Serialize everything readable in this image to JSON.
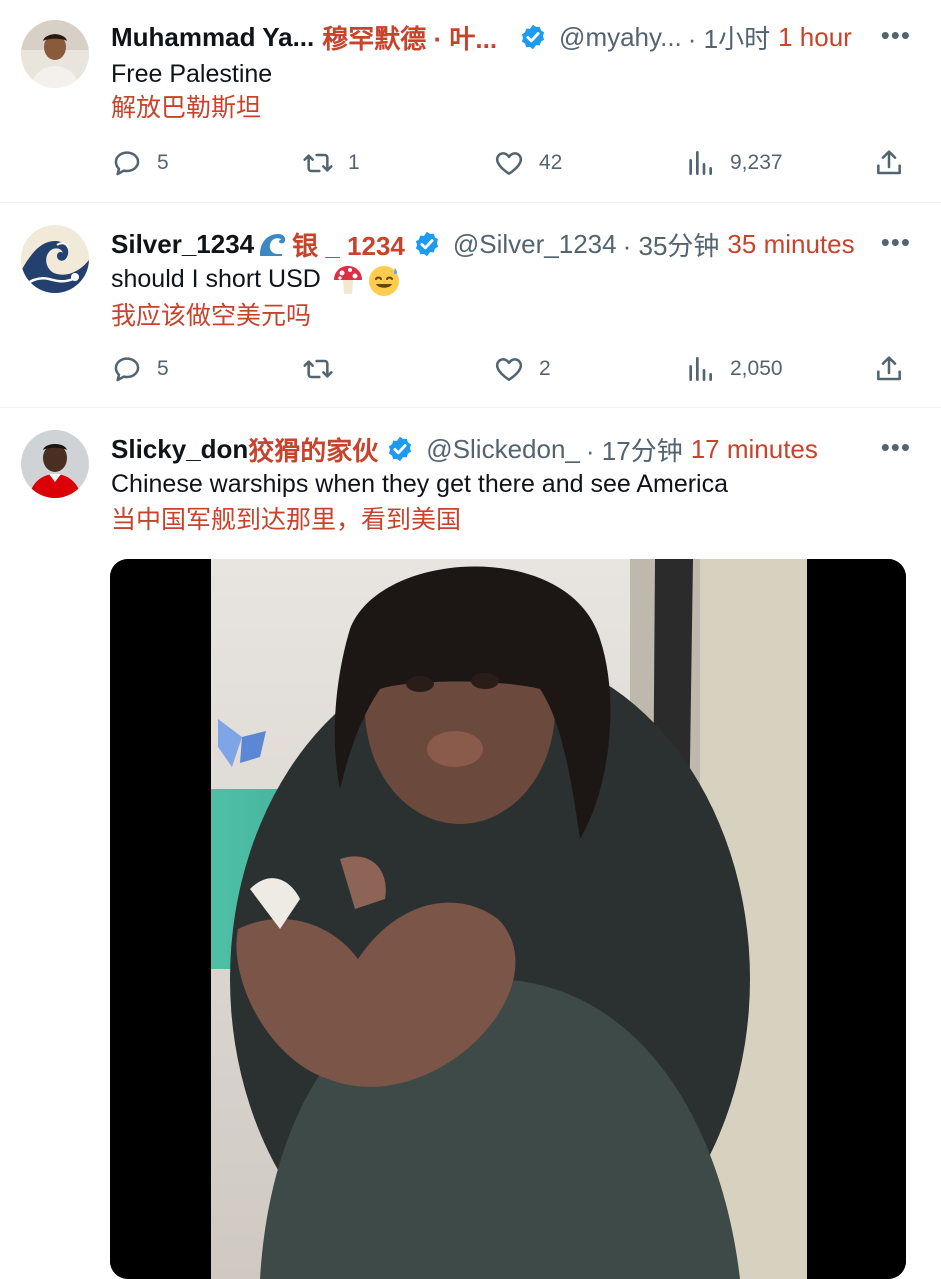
{
  "tweets": [
    {
      "name": "Muhammad Ya...",
      "name_zh": "穆罕默德 · 叶...",
      "handle": "@myahy...",
      "time_zh": "· 1小时",
      "time_en": "1 hour",
      "text": "Free Palestine",
      "text_zh": "解放巴勒斯坦",
      "replies": "5",
      "retweets": "1",
      "likes": "42",
      "views": "9,237"
    },
    {
      "name": "Silver_1234",
      "name_zh": "银 _ 1234",
      "handle": "@Silver_1234",
      "time_zh": "· 35分钟",
      "time_en": "35 minutes",
      "text": "should I short USD",
      "text_zh": "我应该做空美元吗",
      "replies": "5",
      "retweets": "",
      "likes": "2",
      "views": "2,050"
    },
    {
      "name": "Slicky_don",
      "name_zh": "狡猾的家伙",
      "handle": "@Slickedon_",
      "time_zh": "· 17分钟",
      "time_en": "17 minutes",
      "text": "Chinese warships when they get there and see America",
      "text_zh": "当中国军舰到达那里，看到美国"
    }
  ],
  "more_label": "•••",
  "icons": [
    "reply-icon",
    "retweet-icon",
    "like-icon",
    "views-icon",
    "share-icon",
    "verified-badge-icon",
    "more-icon",
    "wave-icon",
    "mushroom-icon",
    "sweat-smile-icon"
  ],
  "colors": {
    "translation": "#c8432c",
    "verified": "#1d9bf0",
    "muted": "#536471"
  }
}
